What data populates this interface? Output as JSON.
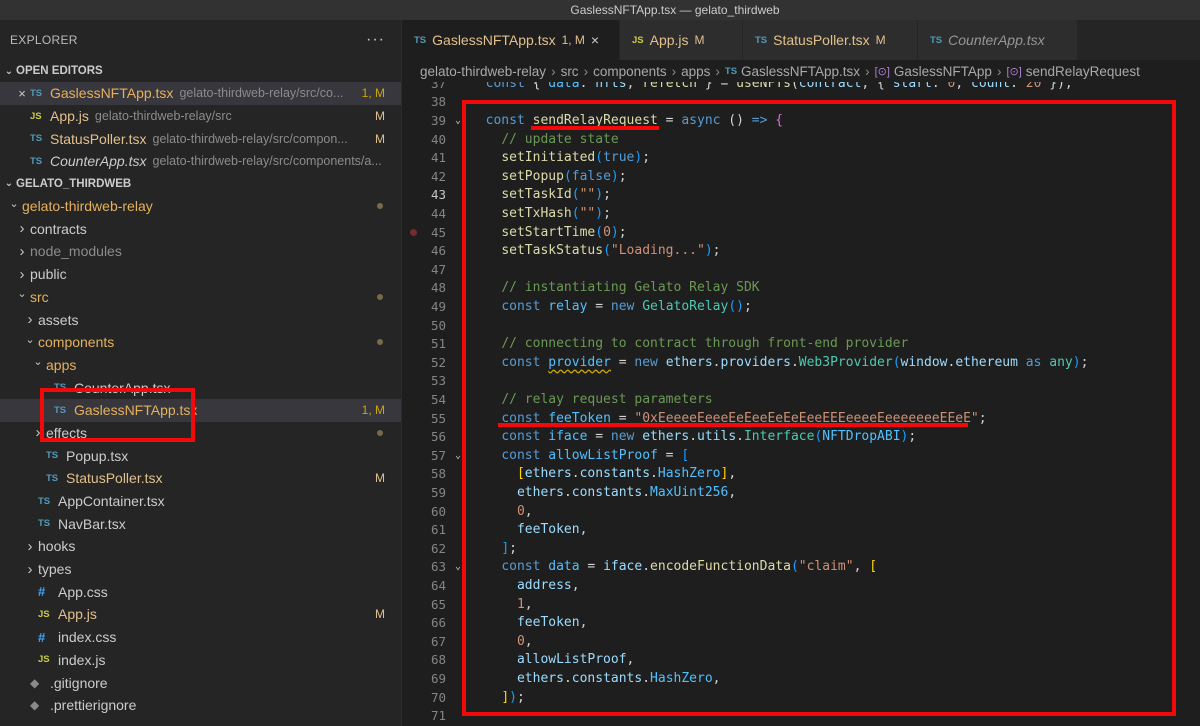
{
  "window": {
    "title": "GaslessNFTApp.tsx — gelato_thirdweb"
  },
  "sidebar": {
    "title": "EXPLORER",
    "more": "···",
    "open_editors_label": "OPEN EDITORS",
    "open_editors": [
      {
        "icon": "TS",
        "name": "GaslessNFTApp.tsx",
        "path": "gelato-thirdweb-relay/src/co...",
        "status": "1, M",
        "active": true
      },
      {
        "icon": "JS",
        "name": "App.js",
        "path": "gelato-thirdweb-relay/src",
        "status": "M"
      },
      {
        "icon": "TS",
        "name": "StatusPoller.tsx",
        "path": "gelato-thirdweb-relay/src/compon...",
        "status": "M"
      },
      {
        "icon": "TS",
        "name": "CounterApp.tsx",
        "path": "gelato-thirdweb-relay/src/components/a...",
        "status": ""
      }
    ],
    "workspace_label": "GELATO_THIRDWEB",
    "tree": [
      {
        "name": "gelato-thirdweb-relay",
        "chev": "v",
        "indent": 0
      },
      {
        "name": "contracts",
        "chev": ">",
        "indent": 1
      },
      {
        "name": "node_modules",
        "chev": ">",
        "indent": 1
      },
      {
        "name": "public",
        "chev": ">",
        "indent": 1
      },
      {
        "name": "src",
        "chev": "v",
        "indent": 1
      },
      {
        "name": "assets",
        "chev": ">",
        "indent": 2
      },
      {
        "name": "components",
        "chev": "v",
        "indent": 2
      },
      {
        "name": "apps",
        "chev": "v",
        "indent": 3
      },
      {
        "icon": "TS",
        "name": "CounterApp.tsx",
        "indent": 4
      },
      {
        "icon": "TS",
        "name": "GaslessNFTApp.tsx",
        "status": "1, M",
        "indent": 4
      },
      {
        "name": "effects",
        "chev": ">",
        "indent": 3
      },
      {
        "icon": "TS",
        "name": "Popup.tsx",
        "indent": 3
      },
      {
        "icon": "TS",
        "name": "StatusPoller.tsx",
        "status": "M",
        "indent": 3
      },
      {
        "icon": "TS",
        "name": "AppContainer.tsx",
        "indent": 2
      },
      {
        "icon": "TS",
        "name": "NavBar.tsx",
        "indent": 2
      },
      {
        "name": "hooks",
        "chev": ">",
        "indent": 2
      },
      {
        "name": "types",
        "chev": ">",
        "indent": 2
      },
      {
        "icon": "#",
        "name": "App.css",
        "indent": 2
      },
      {
        "icon": "JS",
        "name": "App.js",
        "status": "M",
        "indent": 2
      },
      {
        "icon": "#",
        "name": "index.css",
        "indent": 2
      },
      {
        "icon": "JS",
        "name": "index.js",
        "indent": 2
      },
      {
        "icon": "◆",
        "name": ".gitignore",
        "indent": 1
      },
      {
        "icon": "◆",
        "name": ".prettierignore",
        "indent": 1
      }
    ]
  },
  "tabs": [
    {
      "icon": "TS",
      "name": "GaslessNFTApp.tsx",
      "status": "1, M",
      "close": "×",
      "active": true
    },
    {
      "icon": "JS",
      "name": "App.js",
      "status": "M"
    },
    {
      "icon": "TS",
      "name": "StatusPoller.tsx",
      "status": "M"
    },
    {
      "icon": "TS",
      "name": "CounterApp.tsx",
      "status": ""
    }
  ],
  "breadcrumb": {
    "parts": [
      "gelato-thirdweb-relay",
      "src",
      "components",
      "apps"
    ],
    "file_icon": "TS",
    "file": "GaslessNFTApp.tsx",
    "symbol_icon": "[⊙]",
    "symbols": [
      "GaslessNFTApp",
      "sendRelayRequest"
    ]
  },
  "code": {
    "current_line": 43,
    "lines": [
      {
        "n": 37,
        "html": "  <span class=\"kw\">const</span> { <span class=\"cn\">data</span>: <span class=\"vr\">nfts</span>, <span class=\"fn\">refetch</span> } = <span class=\"fn\">useNFTs</span>(<span class=\"vr\">contract</span>, { <span class=\"vr\">start</span>: <span class=\"str\">0</span>, <span class=\"vr\">count</span>: <span class=\"str\">20</span> });"
      },
      {
        "n": 38,
        "html": ""
      },
      {
        "n": 39,
        "fold": "v",
        "html": "  <span class=\"kw\">const</span> <span class=\"fn\">sendRelayRequest</span> = <span class=\"kw\">async</span> () <span class=\"kw\">=&gt;</span> <span class=\"br2\">{</span>"
      },
      {
        "n": 40,
        "html": "    <span class=\"cm\">// update state</span>"
      },
      {
        "n": 41,
        "html": "    <span class=\"fn\">setInitiated</span><span class=\"br3\">(</span><span class=\"kw\">true</span><span class=\"br3\">)</span>;"
      },
      {
        "n": 42,
        "html": "    <span class=\"fn\">setPopup</span><span class=\"br3\">(</span><span class=\"kw\">false</span><span class=\"br3\">)</span>;"
      },
      {
        "n": 43,
        "html": "    <span class=\"fn\">setTaskId</span><span class=\"br3\">(</span><span class=\"str\">\"\"</span><span class=\"br3\">)</span>;"
      },
      {
        "n": 44,
        "html": "    <span class=\"fn\">setTxHash</span><span class=\"br3\">(</span><span class=\"str\">\"\"</span><span class=\"br3\">)</span>;"
      },
      {
        "n": 45,
        "bp": true,
        "html": "    <span class=\"fn\">setStartTime</span><span class=\"br3\">(</span><span class=\"str\">0</span><span class=\"br3\">)</span>;"
      },
      {
        "n": 46,
        "html": "    <span class=\"fn\">setTaskStatus</span><span class=\"br3\">(</span><span class=\"str\">\"Loading...\"</span><span class=\"br3\">)</span>;"
      },
      {
        "n": 47,
        "html": ""
      },
      {
        "n": 48,
        "html": "    <span class=\"cm\">// instantiating Gelato Relay SDK</span>"
      },
      {
        "n": 49,
        "html": "    <span class=\"kw\">const</span> <span class=\"cn\">relay</span> = <span class=\"kw\">new</span> <span class=\"ty\">GelatoRelay</span><span class=\"br3\">()</span>;"
      },
      {
        "n": 50,
        "html": ""
      },
      {
        "n": 51,
        "html": "    <span class=\"cm\">// connecting to contract through front-end provider</span>"
      },
      {
        "n": 52,
        "html": "    <span class=\"kw\">const</span> <span class=\"cn squig\">provider</span> = <span class=\"kw\">new</span> <span class=\"vr\">ethers</span>.<span class=\"vr\">providers</span>.<span class=\"ty\">Web3Provider</span><span class=\"br3\">(</span><span class=\"vr\">window</span>.<span class=\"vr\">ethereum</span> <span class=\"kw\">as</span> <span class=\"ty\">any</span><span class=\"br3\">)</span>;"
      },
      {
        "n": 53,
        "html": ""
      },
      {
        "n": 54,
        "html": "    <span class=\"cm\">// relay request parameters</span>"
      },
      {
        "n": 55,
        "html": "    <span class=\"kw\">const</span> <span class=\"cn\">feeToken</span> = <span class=\"str\">\"0xEeeeeEeeeEeEeeEeEeEeeEEEeeeeEeeeeeeeEEeE\"</span>;"
      },
      {
        "n": 56,
        "html": "    <span class=\"kw\">const</span> <span class=\"cn\">iface</span> = <span class=\"kw\">new</span> <span class=\"vr\">ethers</span>.<span class=\"vr\">utils</span>.<span class=\"ty\">Interface</span><span class=\"br3\">(</span><span class=\"cn\">NFTDropABI</span><span class=\"br3\">)</span>;"
      },
      {
        "n": 57,
        "fold": "v",
        "html": "    <span class=\"kw\">const</span> <span class=\"cn\">allowListProof</span> = <span class=\"br3\">[</span>"
      },
      {
        "n": 58,
        "html": "      <span class=\"br1\">[</span><span class=\"vr\">ethers</span>.<span class=\"vr\">constants</span>.<span class=\"cn\">HashZero</span><span class=\"br1\">]</span>,"
      },
      {
        "n": 59,
        "html": "      <span class=\"vr\">ethers</span>.<span class=\"vr\">constants</span>.<span class=\"cn\">MaxUint256</span>,"
      },
      {
        "n": 60,
        "html": "      <span class=\"str\">0</span>,"
      },
      {
        "n": 61,
        "html": "      <span class=\"vr\">feeToken</span>,"
      },
      {
        "n": 62,
        "html": "    <span class=\"br3\">]</span>;"
      },
      {
        "n": 63,
        "fold": "v",
        "html": "    <span class=\"kw\">const</span> <span class=\"cn\">data</span> = <span class=\"vr\">iface</span>.<span class=\"fn\">encodeFunctionData</span><span class=\"br3\">(</span><span class=\"str\">\"claim\"</span>, <span class=\"br1\">[</span>"
      },
      {
        "n": 64,
        "html": "      <span class=\"vr\">address</span>,"
      },
      {
        "n": 65,
        "html": "      <span class=\"str\">1</span>,"
      },
      {
        "n": 66,
        "html": "      <span class=\"vr\">feeToken</span>,"
      },
      {
        "n": 67,
        "html": "      <span class=\"str\">0</span>,"
      },
      {
        "n": 68,
        "html": "      <span class=\"vr\">allowListProof</span>,"
      },
      {
        "n": 69,
        "html": "      <span class=\"vr\">ethers</span>.<span class=\"vr\">constants</span>.<span class=\"cn\">HashZero</span>,"
      },
      {
        "n": 70,
        "html": "    <span class=\"br1\">]</span><span class=\"br3\">)</span>;"
      },
      {
        "n": 71,
        "html": ""
      }
    ]
  },
  "colors": {
    "annotation": "#f20a0a",
    "accent_modified": "#e2c08d"
  }
}
